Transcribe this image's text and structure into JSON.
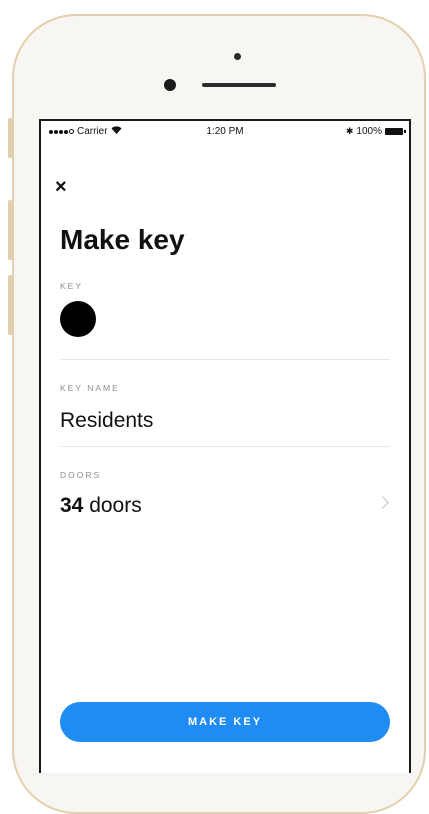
{
  "status_bar": {
    "carrier": "Carrier",
    "time": "1:20 PM",
    "bluetooth": "✱",
    "battery_percent": "100%"
  },
  "header": {
    "close_icon": "×",
    "title": "Make key"
  },
  "form": {
    "key_label": "KEY",
    "key_color": "#000000",
    "key_name_label": "KEY NAME",
    "key_name_value": "Residents",
    "doors_label": "DOORS",
    "doors_count": "34",
    "doors_unit": "doors"
  },
  "footer": {
    "make_key_label": "MAKE KEY",
    "button_color": "#1f8cf4"
  }
}
